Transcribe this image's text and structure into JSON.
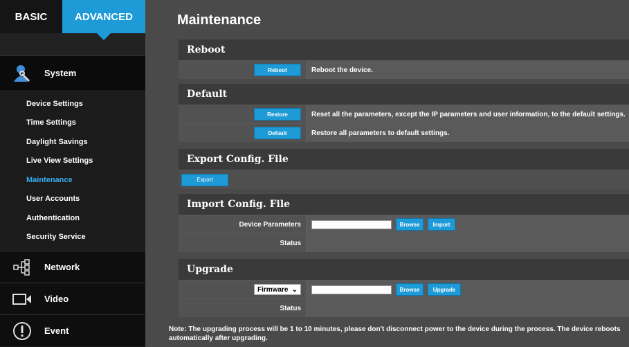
{
  "sidebar": {
    "tabs": {
      "basic": "BASIC",
      "advanced": "ADVANCED"
    },
    "sections": {
      "system": "System",
      "network": "Network",
      "video": "Video",
      "event": "Event"
    },
    "items": [
      "Device Settings",
      "Time Settings",
      "Daylight Savings",
      "Live View Settings",
      "Maintenance",
      "User Accounts",
      "Authentication",
      "Security Service"
    ],
    "active_item": "Maintenance"
  },
  "main": {
    "title": "Maintenance",
    "reboot": {
      "heading": "Reboot",
      "button": "Reboot",
      "description": "Reboot the device."
    },
    "default": {
      "heading": "Default",
      "restore_button": "Restore",
      "restore_description": "Reset all the parameters, except the IP parameters and user information, to the default settings.",
      "default_button": "Default",
      "default_description": "Restore all parameters to default settings."
    },
    "export": {
      "heading": "Export Config. File",
      "button": "Export"
    },
    "import": {
      "heading": "Import Config. File",
      "device_parameters_label": "Device Parameters",
      "browse_button": "Browse",
      "import_button": "Import",
      "status_label": "Status"
    },
    "upgrade": {
      "heading": "Upgrade",
      "select_value": "Firmware",
      "browse_button": "Browse",
      "upgrade_button": "Upgrade",
      "status_label": "Status"
    },
    "note": "Note: The upgrading process will be 1 to 10 minutes, please don't disconnect power to the device during the process. The device reboots automatically after upgrading."
  },
  "colors": {
    "accent": "#1e9bd7",
    "active_item": "#37aef0"
  }
}
